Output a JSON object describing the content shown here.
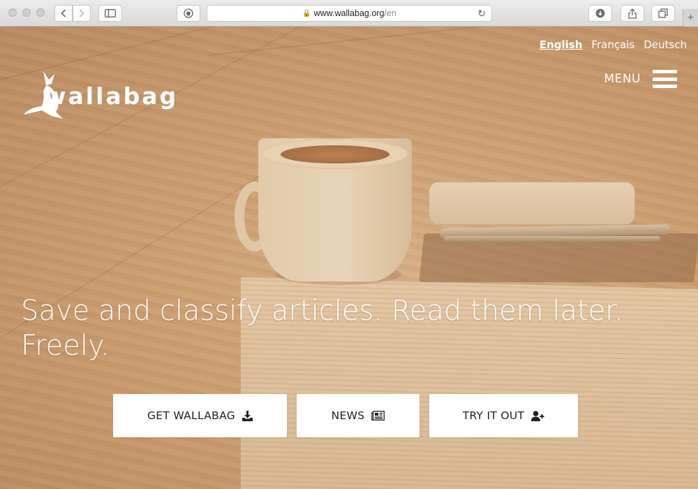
{
  "browser": {
    "url_host": "www.wallabag.org",
    "url_path": "/en",
    "icons": [
      "back-icon",
      "forward-icon",
      "sidebar-icon",
      "shield-icon",
      "lock-icon",
      "reload-icon",
      "download-icon",
      "share-icon",
      "tabs-icon",
      "new-tab-icon"
    ]
  },
  "site": {
    "logo_text": "wallabag",
    "languages": [
      {
        "label": "English",
        "active": true
      },
      {
        "label": "Français",
        "active": false
      },
      {
        "label": "Deutsch",
        "active": false
      }
    ],
    "menu_label": "MENU",
    "headline_line1": "Save and classify articles. Read them later.",
    "headline_line2": "Freely.",
    "buttons": [
      {
        "label": "GET WALLABAG",
        "icon": "download-icon"
      },
      {
        "label": "NEWS",
        "icon": "newspaper-icon"
      },
      {
        "label": "TRY IT OUT",
        "icon": "user-plus-icon"
      }
    ]
  },
  "colors": {
    "hero_tint": "#c9a07a",
    "text_white": "#ffffff",
    "button_bg": "#ffffff",
    "button_text": "#222222"
  }
}
